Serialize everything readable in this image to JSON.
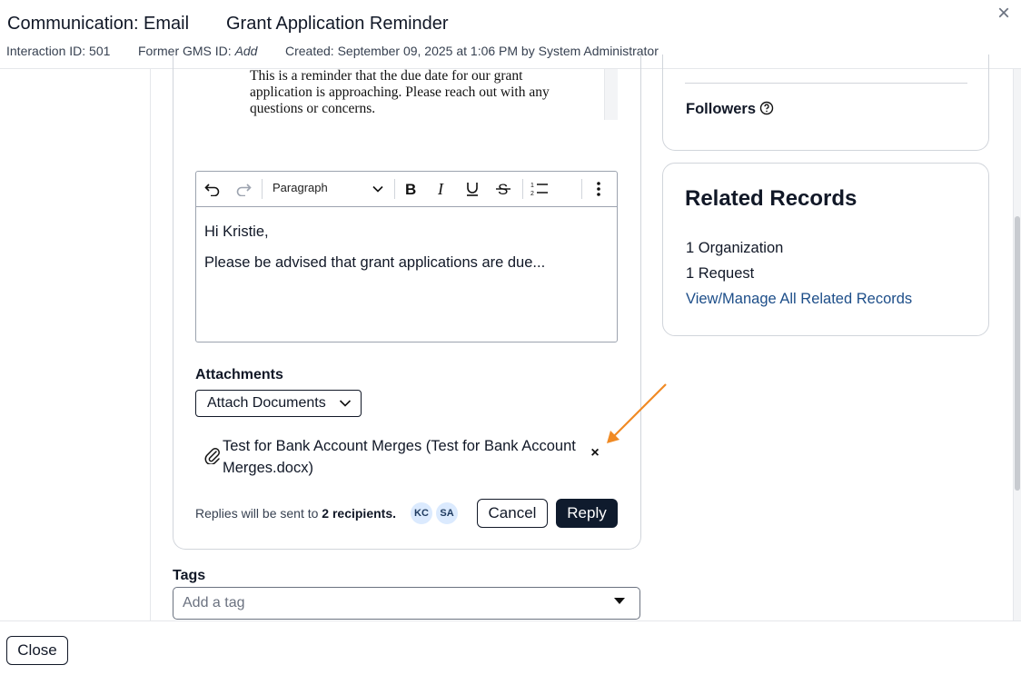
{
  "header": {
    "title": "Communication: Email",
    "subject": "Grant Application Reminder",
    "interaction_id": "Interaction ID: 501",
    "former_gms_label": "Former GMS ID:",
    "former_gms_value": "Add",
    "created": "Created: September 09, 2025 at 1:06 PM by System Administrator",
    "close_icon": "×"
  },
  "quoted_message": {
    "text": "This is a reminder that the due date for our grant application is approaching. Please reach out with any questions or concerns."
  },
  "editor": {
    "block_format": "Paragraph",
    "toolbar_icons": [
      "undo-icon",
      "redo-icon",
      "bold-icon",
      "italic-icon",
      "underline-icon",
      "strikethrough-icon",
      "numbered-list-icon",
      "more-options-icon"
    ],
    "lines": [
      "Hi Kristie,",
      "Please be advised that grant applications are due..."
    ]
  },
  "attachments": {
    "label": "Attachments",
    "attach_button": "Attach Documents",
    "file_name": "Test for Bank Account Merges (Test for Bank Account Merges.docx)",
    "remove_icon": "×"
  },
  "reply_footer": {
    "note_prefix": "Replies will be sent to",
    "note_count": "2 recipients.",
    "avatars": [
      "KC",
      "SA"
    ],
    "cancel": "Cancel",
    "reply": "Reply"
  },
  "tags": {
    "label": "Tags",
    "placeholder": "Add a tag"
  },
  "followers": {
    "label": "Followers"
  },
  "related": {
    "title": "Related Records",
    "items": [
      "1 Organization",
      "1 Request"
    ],
    "link": "View/Manage All Related Records"
  },
  "footer": {
    "close": "Close"
  },
  "colors": {
    "primary_button": "#0f1b2d",
    "link": "#1d4e89",
    "annotation_arrow": "#f08a24",
    "avatar_bg": "#dbeafe"
  }
}
